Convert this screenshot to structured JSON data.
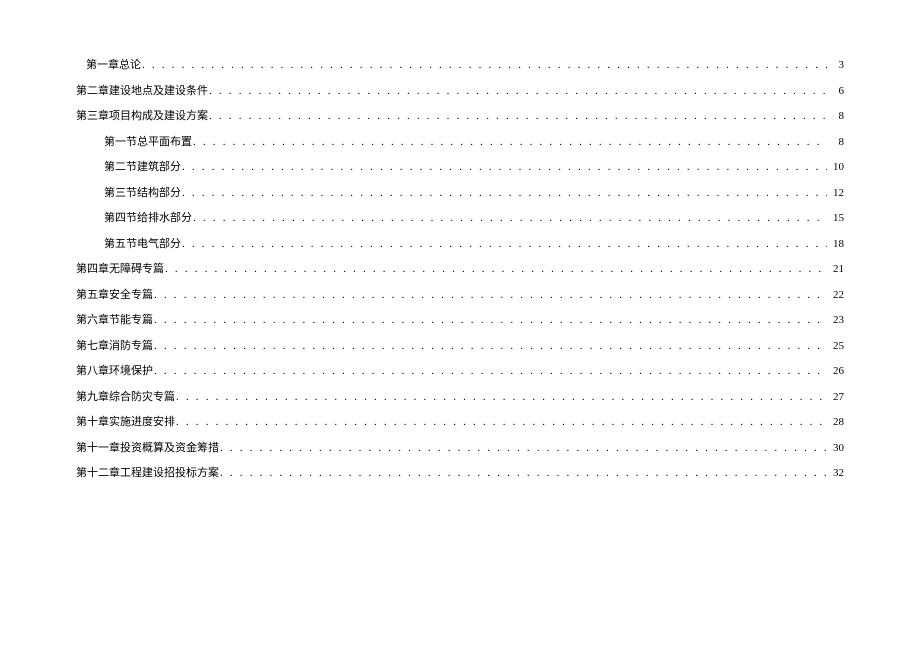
{
  "toc": [
    {
      "title": "第一章总论",
      "page": "3",
      "cls": "first"
    },
    {
      "title": "第二章建设地点及建设条件",
      "page": "6",
      "cls": ""
    },
    {
      "title": "第三章项目构成及建设方案",
      "page": "8",
      "cls": ""
    },
    {
      "title": "第一节总平面布置",
      "page": "8",
      "cls": "sub"
    },
    {
      "title": "第二节建筑部分",
      "page": "10",
      "cls": "sub"
    },
    {
      "title": "第三节结构部分",
      "page": "12",
      "cls": "sub"
    },
    {
      "title": "第四节给排水部分",
      "page": "15",
      "cls": "sub"
    },
    {
      "title": "第五节电气部分",
      "page": "18",
      "cls": "sub"
    },
    {
      "title": "第四章无障碍专篇",
      "page": "21",
      "cls": ""
    },
    {
      "title": "第五章安全专篇",
      "page": "22",
      "cls": ""
    },
    {
      "title": "第六章节能专篇",
      "page": "23",
      "cls": ""
    },
    {
      "title": "第七章消防专篇",
      "page": "25",
      "cls": ""
    },
    {
      "title": "第八章环境保护",
      "page": "26",
      "cls": ""
    },
    {
      "title": "第九章综合防灾专篇",
      "page": "27",
      "cls": ""
    },
    {
      "title": "第十章实施进度安排",
      "page": "28",
      "cls": ""
    },
    {
      "title": "第十一章投资概算及资金筹措",
      "page": "30",
      "cls": ""
    },
    {
      "title": "第十二章工程建设招投标方案",
      "page": "32",
      "cls": ""
    }
  ]
}
